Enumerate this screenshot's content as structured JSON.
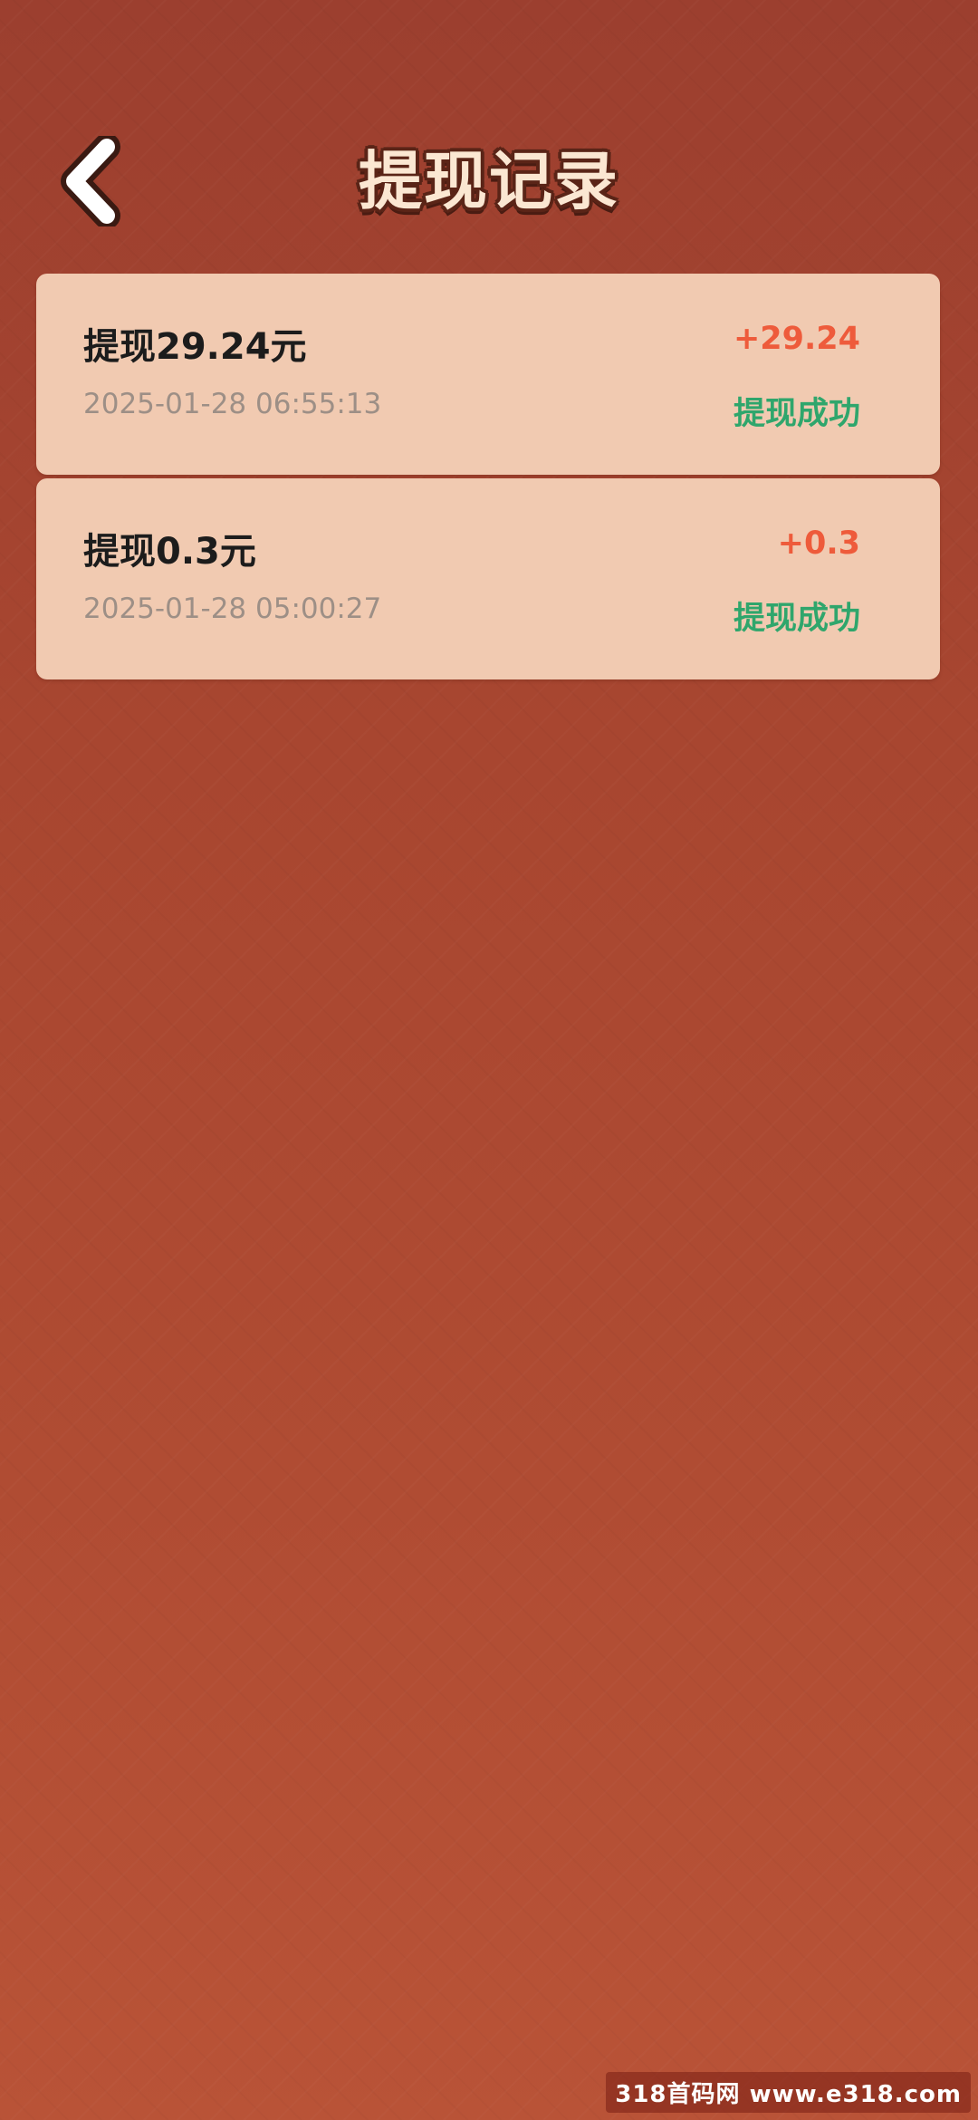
{
  "header": {
    "title": "提现记录",
    "back_icon": "chevron-left-icon"
  },
  "records": [
    {
      "title": "提现29.24元",
      "time": "2025-01-28 06:55:13",
      "amount": "+29.24",
      "status": "提现成功"
    },
    {
      "title": "提现0.3元",
      "time": "2025-01-28 05:00:27",
      "amount": "+0.3",
      "status": "提现成功"
    }
  ],
  "watermark": "318首码网 www.e318.com",
  "colors": {
    "background": "#a84630",
    "card": "#f1cab1",
    "amount": "#ee5b3b",
    "status": "#2fa66c",
    "time": "#9d8f86",
    "title_text": "#fbe7d2",
    "title_outline": "#5a2417"
  }
}
